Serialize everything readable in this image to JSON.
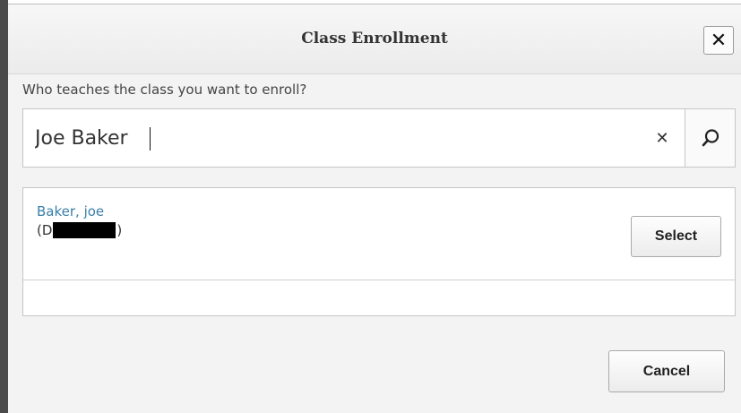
{
  "dialog": {
    "title": "Class Enrollment",
    "close_icon": "close-icon",
    "close_glyph": "✕"
  },
  "search": {
    "prompt": "Who teaches the class you want to enroll?",
    "value": "Joe Baker",
    "clear_icon": "clear-icon",
    "clear_glyph": "✕",
    "search_icon": "search-icon"
  },
  "results": {
    "items": [
      {
        "name": "Baker, joe",
        "id_prefix": "(D",
        "id_suffix": ")",
        "select_label": "Select"
      }
    ]
  },
  "footer": {
    "cancel_label": "Cancel"
  },
  "colors": {
    "link": "#3a7fa8",
    "dialog_bg": "#f3f3f3"
  }
}
